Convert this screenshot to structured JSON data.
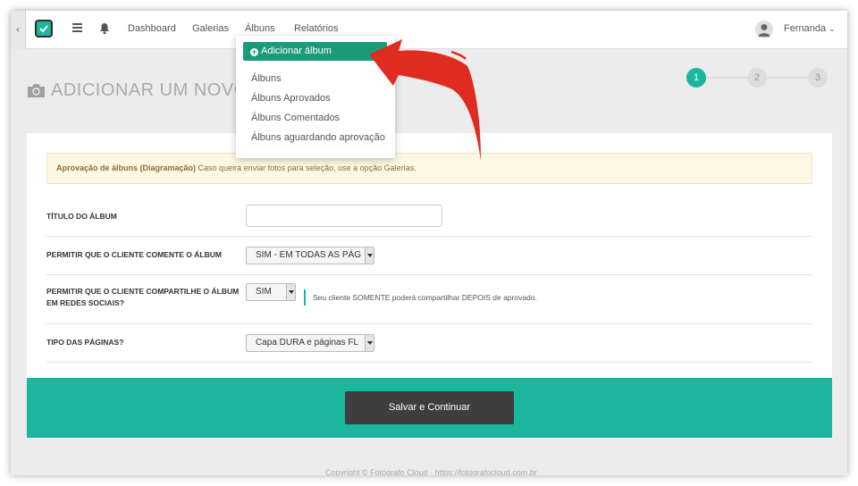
{
  "topbar": {
    "back_label": "‹",
    "nav": [
      {
        "label": "Dashboard"
      },
      {
        "label": "Galerias"
      },
      {
        "label": "Álbuns"
      },
      {
        "label": "Relatórios"
      }
    ],
    "user_name": "Fernanda",
    "user_caret": "⌄"
  },
  "icons": {
    "logo": "check-square-icon",
    "menu": "hamburger-icon",
    "notifications": "bell-icon",
    "title": "camera-icon",
    "avatar": "user-icon"
  },
  "page": {
    "title": "ADICIONAR UM NOVO"
  },
  "steps": [
    "1",
    "2",
    "3"
  ],
  "alert": {
    "bold": "Aprovação de álbuns (Diagramação)",
    "text": " Caso queira enviar fotos para seleção, use a opção Galerias."
  },
  "form": {
    "title_label": "TÍTULO DO ÁLBUM",
    "title_value": "",
    "comment_label": "PERMITIR QUE O CLIENTE COMENTE O ÁLBUM",
    "comment_value": "SIM - EM TODAS AS PÁG",
    "share_label": "PERMITIR QUE O CLIENTE COMPARTILHE O ÁLBUM EM REDES SOCIAIS?",
    "share_value": "SIM",
    "share_help": "Seu cliente SOMENTE poderá compartilhar DEPOIS de aprovado.",
    "pages_label": "TIPO DAS PÁGINAS?",
    "pages_value": "Capa DURA e páginas FL"
  },
  "actions": {
    "save_label": "Salvar e Continuar"
  },
  "footer": {
    "text": "Copyright © Fotógrafo Cloud · https://fotografocloud.com.br"
  },
  "dropdown": {
    "primary": "Adicionar álbum",
    "items": [
      {
        "label": "Álbuns"
      },
      {
        "label": "Álbuns Aprovados"
      },
      {
        "label": "Álbuns Comentados"
      },
      {
        "label": "Álbuns aguardando aprovação"
      }
    ]
  },
  "colors": {
    "accent": "#1ab69d",
    "dropdown_primary": "#1a9b7b",
    "annotation_arrow": "#e02b20",
    "save_button": "#3e3e3e"
  }
}
